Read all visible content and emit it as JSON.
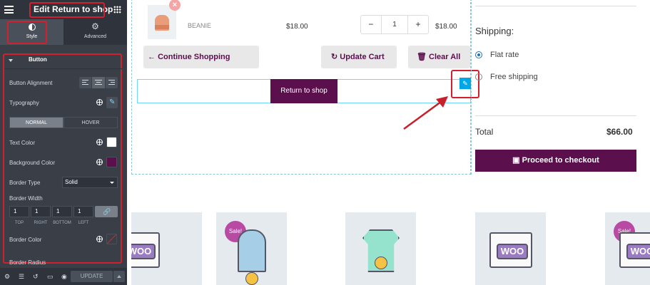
{
  "panel": {
    "title": "Edit Return to shop",
    "tabs": [
      {
        "label": "Style",
        "icon": "half-circle-icon"
      },
      {
        "label": "Advanced",
        "icon": "gear-icon"
      }
    ],
    "section_title": "Button",
    "controls": {
      "button_alignment": "Button Alignment",
      "typography": "Typography",
      "state_tabs": [
        "NORMAL",
        "HOVER"
      ],
      "text_color": "Text Color",
      "text_color_value": "#ffffff",
      "background_color": "Background Color",
      "background_color_value": "#5b0f4d",
      "border_type": "Border Type",
      "border_type_value": "Solid",
      "border_width": "Border Width",
      "border_width_values": [
        "1",
        "1",
        "1",
        "1"
      ],
      "border_width_labels": [
        "TOP",
        "RIGHT",
        "BOTTOM",
        "LEFT"
      ],
      "border_color": "Border Color",
      "border_radius": "Border Radius"
    },
    "footer": {
      "update_label": "UPDATE"
    }
  },
  "cart": {
    "product_name": "BEANIE",
    "price": "$18.00",
    "quantity": "1",
    "qty_minus": "−",
    "qty_plus": "+",
    "subtotal": "$18.00",
    "continue_label": "Continue Shopping",
    "update_label": "Update Cart",
    "clear_label": "Clear All",
    "return_label": "Return to shop"
  },
  "totals": {
    "shipping_title": "Shipping:",
    "options": [
      "Flat rate",
      "Free shipping"
    ],
    "total_label": "Total",
    "total_value": "$66.00",
    "checkout_label": "Proceed to checkout"
  },
  "products": {
    "woo_text": "WOO",
    "sale_label": "Sale!"
  },
  "colors": {
    "accent": "#5b0f4d",
    "panel_bg": "#393e47",
    "highlight": "#d3202e",
    "edit_blue": "#00a7e6"
  }
}
